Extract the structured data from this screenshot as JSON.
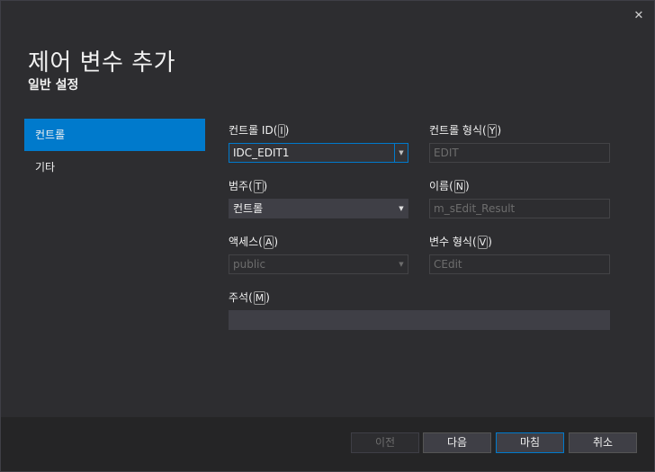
{
  "dialog": {
    "title": "제어 변수 추가",
    "subtitle": "일반 설정",
    "close_glyph": "✕"
  },
  "nav": {
    "items": [
      {
        "label": "컨트롤",
        "selected": true
      },
      {
        "label": "기타",
        "selected": false
      }
    ]
  },
  "form": {
    "control_id": {
      "label": "컨트롤 ID",
      "mnemonic": "I",
      "value": "IDC_EDIT1"
    },
    "control_type": {
      "label": "컨트롤 형식",
      "mnemonic": "Y",
      "value": "EDIT"
    },
    "category": {
      "label": "범주",
      "mnemonic": "T",
      "value": "컨트롤"
    },
    "name": {
      "label": "이름",
      "mnemonic": "N",
      "value": "m_sEdit_Result"
    },
    "access": {
      "label": "액세스",
      "mnemonic": "A",
      "value": "public"
    },
    "var_type": {
      "label": "변수 형식",
      "mnemonic": "V",
      "value": "CEdit"
    },
    "comment": {
      "label": "주석",
      "mnemonic": "M",
      "value": ""
    }
  },
  "footer": {
    "prev_label": "이전",
    "next_label": "다음",
    "finish_label": "마침",
    "cancel_label": "취소"
  },
  "icons": {
    "dropdown": "▼"
  },
  "colors": {
    "accent": "#007acc",
    "background": "#2d2d30",
    "footer": "#252526"
  }
}
